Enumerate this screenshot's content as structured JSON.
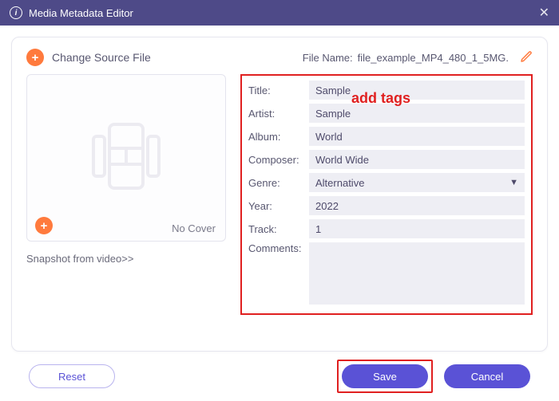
{
  "window": {
    "title": "Media Metadata Editor"
  },
  "header": {
    "change_source_label": "Change Source File",
    "file_name_label": "File Name:",
    "file_name_value": "file_example_MP4_480_1_5MG."
  },
  "annot": {
    "add_tags": "add tags"
  },
  "cover": {
    "no_cover_label": "No Cover",
    "snapshot_label": "Snapshot from video>>"
  },
  "fields": {
    "title": {
      "label": "Title:",
      "value": "Sample"
    },
    "artist": {
      "label": "Artist:",
      "value": "Sample"
    },
    "album": {
      "label": "Album:",
      "value": "World"
    },
    "composer": {
      "label": "Composer:",
      "value": "World Wide"
    },
    "genre": {
      "label": "Genre:",
      "value": "Alternative"
    },
    "year": {
      "label": "Year:",
      "value": "2022"
    },
    "track": {
      "label": "Track:",
      "value": "1"
    },
    "comments": {
      "label": "Comments:",
      "value": ""
    }
  },
  "footer": {
    "reset": "Reset",
    "save": "Save",
    "cancel": "Cancel"
  }
}
